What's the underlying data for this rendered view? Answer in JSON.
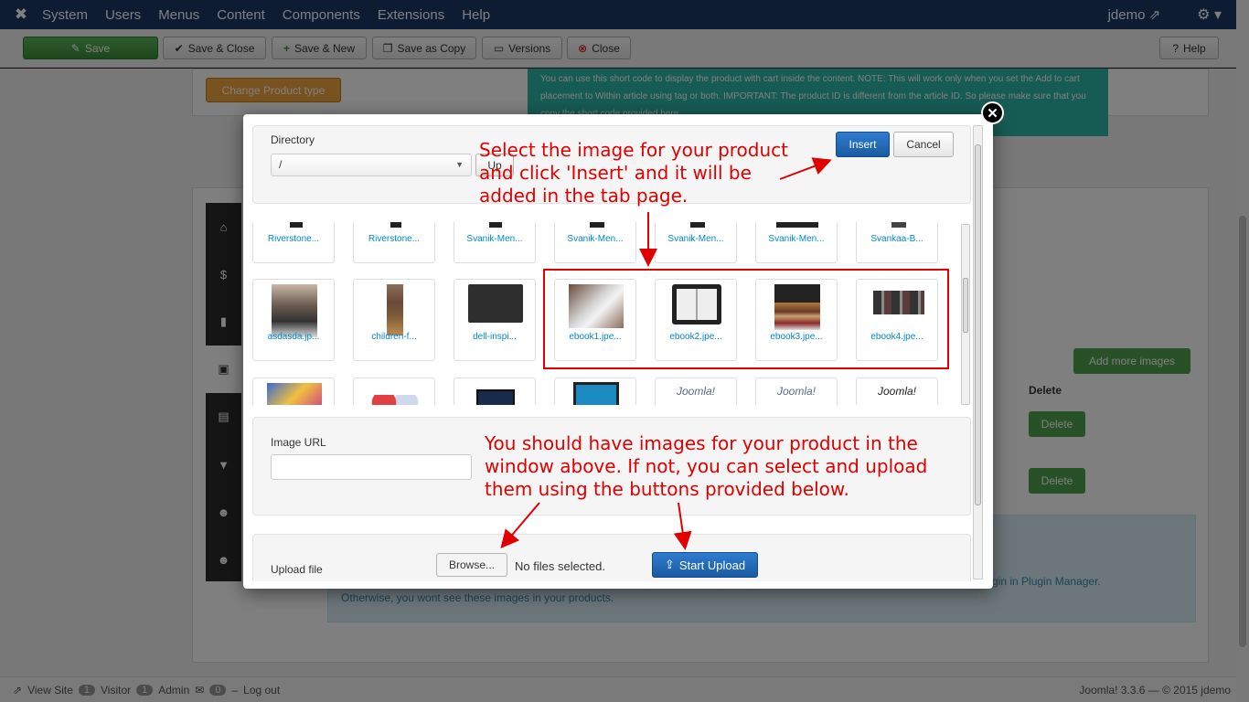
{
  "topnav": {
    "logo": "✖",
    "items": [
      "System",
      "Users",
      "Menus",
      "Content",
      "Components",
      "Extensions",
      "Help"
    ],
    "user": "jdemo ⇗",
    "cog": "⚙ ▾"
  },
  "toolbar": {
    "save": "Save",
    "save_close": "Save & Close",
    "save_new": "Save & New",
    "save_copy": "Save as Copy",
    "versions": "Versions",
    "close": "Close",
    "help": "Help"
  },
  "page": {
    "change_type": "Change Product type",
    "info_text": "You can use this short code to display the product with cart inside the content. NOTE: This will work only when you set the Add to cart placement to Within article using tag or both. IMPORTANT: The product ID is different from the article ID. So please make sure that you copy the short code provided here.",
    "add_more": "Add more images",
    "delete_header": "Delete",
    "delete1": "Delete",
    "delete2": "Delete",
    "blue_line1": "gin in Plugin Manager.",
    "blue_line2": "Otherwise, you wont see these images in your products."
  },
  "footer": {
    "view_site": "View Site",
    "visitor_count": "1",
    "visitor": "Visitor",
    "admin_count": "1",
    "admin": "Admin",
    "msg_count": "0",
    "logout": "Log out",
    "version": "Joomla! 3.3.6 — © 2015 jdemo"
  },
  "modal": {
    "directory_label": "Directory",
    "directory_value": "/",
    "up": "Up",
    "insert": "Insert",
    "cancel": "Cancel",
    "row1": [
      "Riverstone...",
      "Riverstone...",
      "Svanik-Men...",
      "Svanik-Men...",
      "Svanik-Men...",
      "Svanik-Men...",
      "Svankaa-B..."
    ],
    "row2": [
      "asdasda.jp...",
      "children-f...",
      "dell-inspi...",
      "ebook1.jpe...",
      "ebook2.jpe...",
      "ebook3.jpe...",
      "ebook4.jpe..."
    ],
    "row3": [
      "",
      "",
      "",
      "",
      "Joomla!",
      "Joomla!",
      "Joomla!"
    ],
    "image_url_label": "Image URL",
    "upload_label": "Upload file",
    "browse": "Browse...",
    "no_files": "No files selected.",
    "start_upload": "Start Upload"
  },
  "annotations": {
    "a1": [
      "Select the image for your product",
      "and click 'Insert' and it will be",
      "added in the tab page."
    ],
    "a2": [
      "You should have images for your product in the",
      "window above. If not, you can select and upload",
      "them using the buttons provided below."
    ]
  },
  "colors": {
    "annotation": "#e00000",
    "nav": "#1a3867",
    "primary": "#1a5aa3",
    "success": "#51a351"
  }
}
